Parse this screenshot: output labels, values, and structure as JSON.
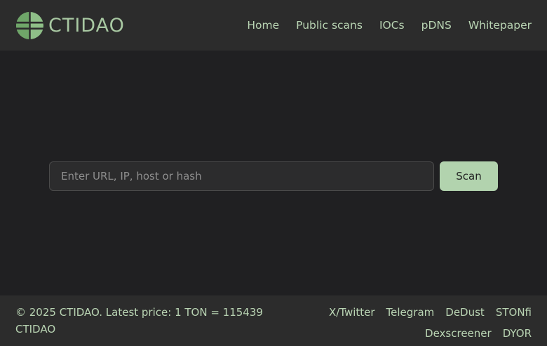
{
  "brand": {
    "name": "CTIDAO",
    "logo_icon": "globe-leaf-icon",
    "color": "#a8c8a2"
  },
  "nav": [
    {
      "label": "Home"
    },
    {
      "label": "Public scans"
    },
    {
      "label": "IOCs"
    },
    {
      "label": "pDNS"
    },
    {
      "label": "Whitepaper"
    }
  ],
  "search": {
    "placeholder": "Enter URL, IP, host or hash",
    "value": "",
    "button_label": "Scan",
    "button_color": "#b2d3ae"
  },
  "footer": {
    "copyright": "© 2025 CTIDAO. Latest price: 1 TON = 115439 CTIDAO",
    "links": [
      {
        "label": "X/Twitter"
      },
      {
        "label": "Telegram"
      },
      {
        "label": "DeDust"
      },
      {
        "label": "STONfi"
      },
      {
        "label": "Dexscreener"
      },
      {
        "label": "DYOR"
      }
    ]
  },
  "colors": {
    "background": "#202022",
    "header_bg": "#2c2c2c",
    "accent_text": "#b9d4b3"
  }
}
